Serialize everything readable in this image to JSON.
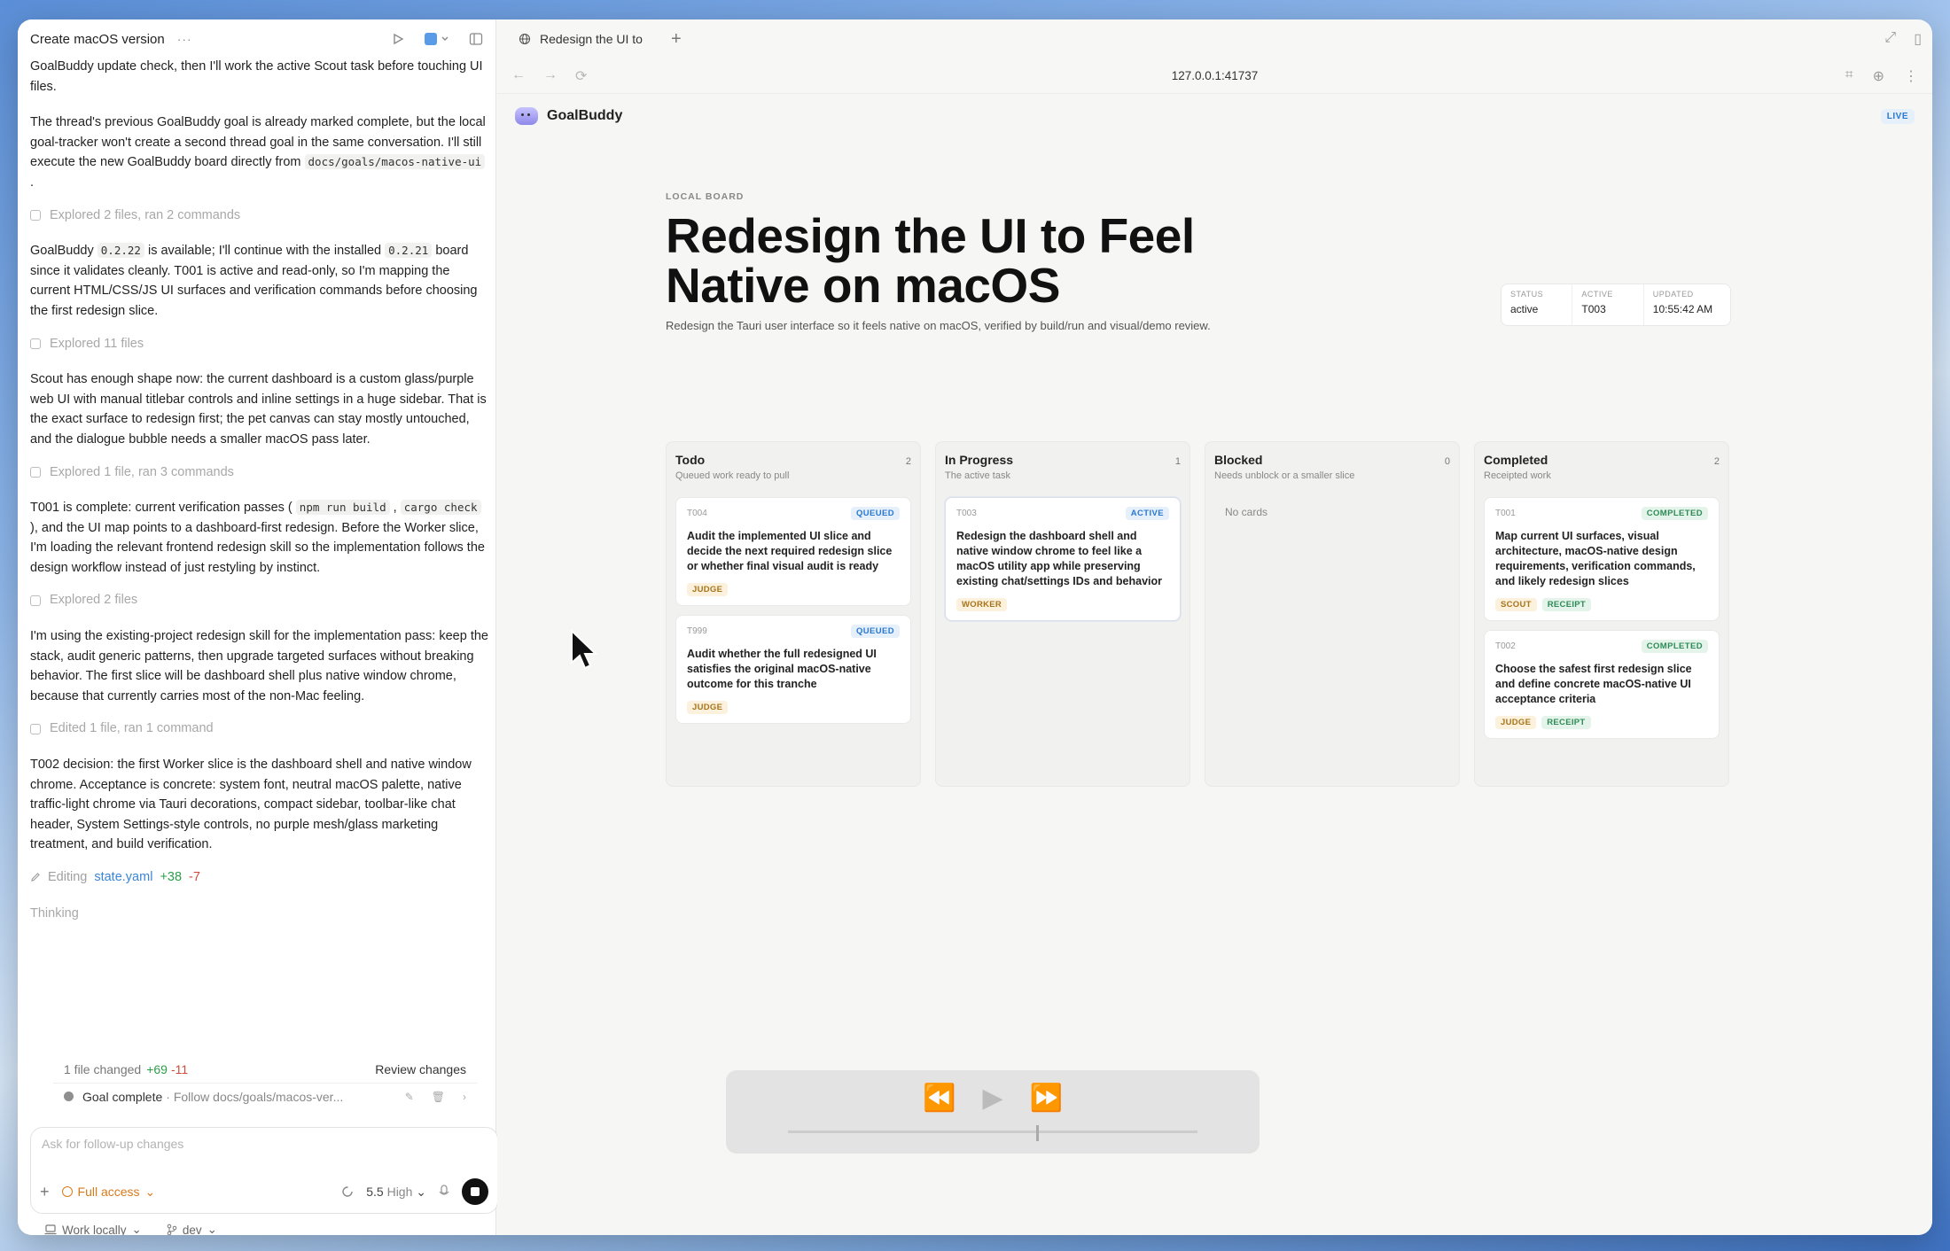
{
  "thread": {
    "title": "Create macOS version",
    "menu": "···"
  },
  "feed": {
    "p0_a": "GoalBuddy update check, then I'll work the active Scout task before touching UI files.",
    "p1_a": "The thread's previous GoalBuddy goal is already marked complete, but the local goal-tracker won't create a second thread goal in the same conversation. I'll still execute the new GoalBuddy board directly from",
    "p1_code": "docs/goals/macos-native-ui",
    "p1_b": ".",
    "exp1": "Explored 2 files, ran 2 commands",
    "p2_a": "GoalBuddy",
    "p2_code1": "0.2.22",
    "p2_b": "is available; I'll continue with the installed",
    "p2_code2": "0.2.21",
    "p2_c": "board since it validates cleanly. T001 is active and read-only, so I'm mapping the current HTML/CSS/JS UI surfaces and verification commands before choosing the first redesign slice.",
    "exp2": "Explored 11 files",
    "p3": "Scout has enough shape now: the current dashboard is a custom glass/purple web UI with manual titlebar controls and inline settings in a huge sidebar. That is the exact surface to redesign first; the pet canvas can stay mostly untouched, and the dialogue bubble needs a smaller macOS pass later.",
    "exp3": "Explored 1 file, ran 3 commands",
    "p4_a": "T001 is complete: current verification passes (",
    "p4_code1": "npm run build",
    "p4_b": ",",
    "p4_code2": "cargo check",
    "p4_c": "), and the UI map points to a dashboard-first redesign. Before the Worker slice, I'm loading the relevant frontend redesign skill so the implementation follows the design workflow instead of just restyling by instinct.",
    "exp4": "Explored 2 files",
    "p5": "I'm using the existing-project redesign skill for the implementation pass: keep the stack, audit generic patterns, then upgrade targeted surfaces without breaking behavior. The first slice will be dashboard shell plus native window chrome, because that currently carries most of the non-Mac feeling.",
    "exp5": "Edited 1 file, ran 1 command",
    "p6": "T002 decision: the first Worker slice is the dashboard shell and native window chrome. Acceptance is concrete: system font, neutral macOS palette, native traffic-light chrome via Tauri decorations, compact sidebar, toolbar-like chat header, System Settings-style controls, no purple mesh/glass marketing treatment, and build verification.",
    "editing_label": "Editing",
    "editing_file": "state.yaml",
    "editing_plus": "+38",
    "editing_minus": "-7",
    "thinking": "Thinking"
  },
  "changes": {
    "summary": "1 file changed",
    "plus": "+69",
    "minus": "-11",
    "review": "Review changes",
    "goal_label": "Goal complete",
    "goal_detail": "· Follow docs/goals/macos-ver..."
  },
  "composer": {
    "placeholder": "Ask for follow-up changes",
    "access": "Full access",
    "model": "5.5",
    "level": "High",
    "work_mode": "Work locally",
    "branch": "dev"
  },
  "browser": {
    "tab_title": "Redesign the UI to",
    "url": "127.0.0.1:41737"
  },
  "app": {
    "brand": "GoalBuddy",
    "live": "LIVE",
    "eyebrow": "LOCAL BOARD",
    "title": "Redesign the UI to Feel Native on macOS",
    "subtitle": "Redesign the Tauri user interface so it feels native on macOS, verified by build/run and visual/demo review.",
    "meta": {
      "status_k": "STATUS",
      "status_v": "active",
      "active_k": "ACTIVE",
      "active_v": "T003",
      "updated_k": "UPDATED",
      "updated_v": "10:55:42 AM"
    }
  },
  "columns": {
    "todo": {
      "name": "Todo",
      "count": "2",
      "desc": "Queued work ready to pull",
      "cards": [
        {
          "id": "T004",
          "status": "QUEUED",
          "text": "Audit the implemented UI slice and decide the next required redesign slice or whether final visual audit is ready",
          "tags": [
            "JUDGE"
          ]
        },
        {
          "id": "T999",
          "status": "QUEUED",
          "text": "Audit whether the full redesigned UI satisfies the original macOS-native outcome for this tranche",
          "tags": [
            "JUDGE"
          ]
        }
      ]
    },
    "progress": {
      "name": "In Progress",
      "count": "1",
      "desc": "The active task",
      "cards": [
        {
          "id": "T003",
          "status": "ACTIVE",
          "text": "Redesign the dashboard shell and native window chrome to feel like a macOS utility app while preserving existing chat/settings IDs and behavior",
          "tags": [
            "WORKER"
          ]
        }
      ]
    },
    "blocked": {
      "name": "Blocked",
      "count": "0",
      "desc": "Needs unblock or a smaller slice",
      "empty": "No cards"
    },
    "completed": {
      "name": "Completed",
      "count": "2",
      "desc": "Receipted work",
      "cards": [
        {
          "id": "T001",
          "status": "COMPLETED",
          "text": "Map current UI surfaces, visual architecture, macOS-native design requirements, verification commands, and likely redesign slices",
          "tags": [
            "SCOUT",
            "RECEIPT"
          ]
        },
        {
          "id": "T002",
          "status": "COMPLETED",
          "text": "Choose the safest first redesign slice and define concrete macOS-native UI acceptance criteria",
          "tags": [
            "JUDGE",
            "RECEIPT"
          ]
        }
      ]
    }
  }
}
